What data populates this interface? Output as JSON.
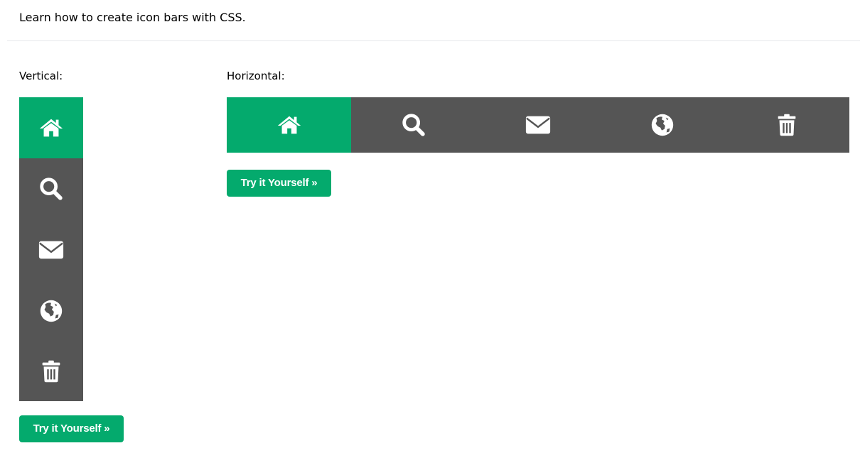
{
  "intro_text": "Learn how to create icon bars with CSS.",
  "vertical": {
    "label": "Vertical:",
    "items": [
      {
        "icon": "home-icon",
        "active": true
      },
      {
        "icon": "search-icon",
        "active": false
      },
      {
        "icon": "envelope-icon",
        "active": false
      },
      {
        "icon": "globe-icon",
        "active": false
      },
      {
        "icon": "trash-icon",
        "active": false
      }
    ],
    "button_label": "Try it Yourself »"
  },
  "horizontal": {
    "label": "Horizontal:",
    "items": [
      {
        "icon": "home-icon",
        "active": true
      },
      {
        "icon": "search-icon",
        "active": false
      },
      {
        "icon": "envelope-icon",
        "active": false
      },
      {
        "icon": "globe-icon",
        "active": false
      },
      {
        "icon": "trash-icon",
        "active": false
      }
    ],
    "button_label": "Try it Yourself »"
  },
  "colors": {
    "accent": "#04aa6d",
    "bar_background": "#555555",
    "icon": "#ffffff"
  }
}
